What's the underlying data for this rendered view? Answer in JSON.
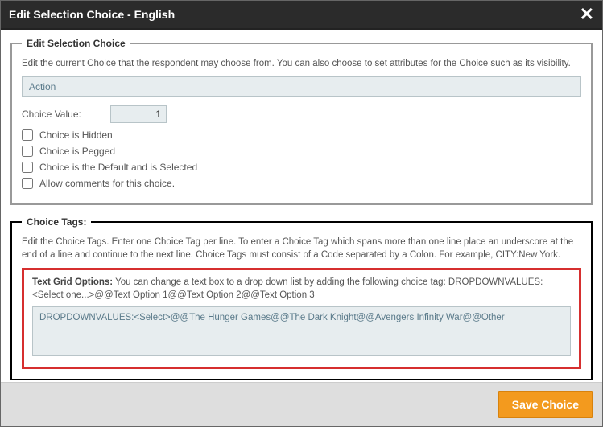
{
  "header": {
    "title": "Edit Selection Choice  -  English"
  },
  "section1": {
    "legend": "Edit Selection Choice",
    "help": "Edit the current Choice that the respondent may choose from. You can also choose to set attributes for the Choice such as its visibility.",
    "choice_name": "Action",
    "choice_value_label": "Choice Value:",
    "choice_value": "1",
    "cb_hidden": "Choice is Hidden",
    "cb_pegged": "Choice is Pegged",
    "cb_default": "Choice is the Default and is Selected",
    "cb_comments": "Allow comments for this choice."
  },
  "section2": {
    "legend": "Choice Tags:",
    "help": "Edit the Choice Tags. Enter one Choice Tag per line. To enter a Choice Tag which spans more than one line place an underscore at the end of a line and continue to the next line. Choice Tags must consist of a Code separated by a Colon. For example, CITY:New York.",
    "grid_hint_bold": "Text Grid Options:",
    "grid_hint_rest": " You can change a text box to a drop down list by adding the following choice tag: DROPDOWNVALUES:<Select one...>@@Text Option 1@@Text Option 2@@Text Option 3",
    "tags_value": "DROPDOWNVALUES:<Select>@@The Hunger Games@@The Dark Knight@@Avengers Infinity War@@Other"
  },
  "footer": {
    "save_label": "Save Choice"
  }
}
